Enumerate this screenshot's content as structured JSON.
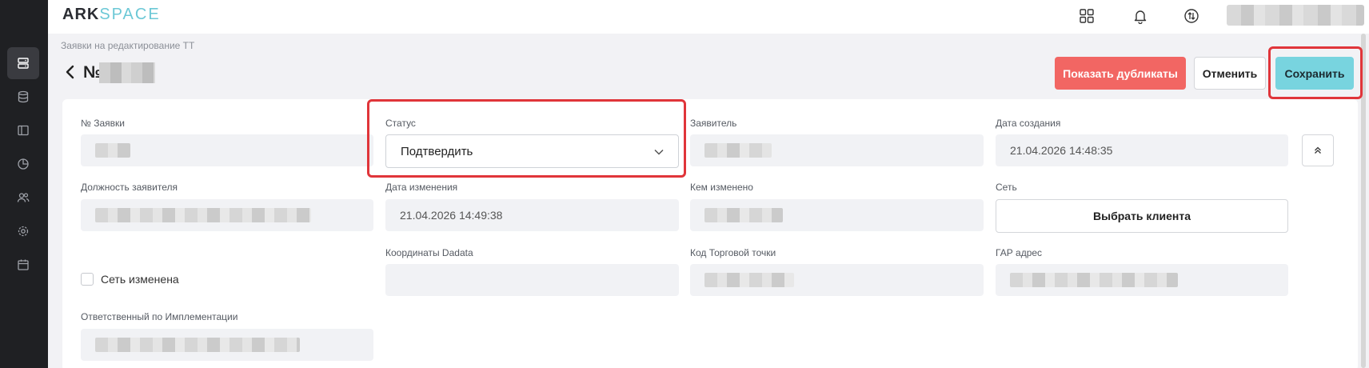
{
  "app": {
    "logo_part1": "ARK",
    "logo_part2": "SPACE"
  },
  "header": {
    "icons": [
      "grid-icon",
      "bell-icon",
      "exchange-icon"
    ]
  },
  "sidebar": {
    "items": [
      {
        "icon": "server-icon",
        "active": true
      },
      {
        "icon": "database-icon",
        "active": false
      },
      {
        "icon": "layout-icon",
        "active": false
      },
      {
        "icon": "pie-chart-icon",
        "active": false
      },
      {
        "icon": "users-icon",
        "active": false
      },
      {
        "icon": "settings-icon",
        "active": false
      },
      {
        "icon": "calendar-icon",
        "active": false
      }
    ]
  },
  "breadcrumb": "Заявки на редактирование ТТ",
  "page": {
    "title_prefix": "№"
  },
  "toolbar": {
    "show_duplicates": "Показать дубликаты",
    "cancel": "Отменить",
    "save": "Сохранить"
  },
  "form": {
    "request_no_label": "№ Заявки",
    "status_label": "Статус",
    "status_value": "Подтвердить",
    "applicant_label": "Заявитель",
    "created_label": "Дата создания",
    "created_value": "21.04.2026 14:48:35",
    "position_label": "Должность заявителя",
    "changed_label": "Дата изменения",
    "changed_value": "21.04.2026 14:49:38",
    "changed_by_label": "Кем изменено",
    "network_label": "Сеть",
    "choose_client": "Выбрать клиента",
    "network_changed_label": "Сеть изменена",
    "network_changed_checked": false,
    "dadata_label": "Координаты Dadata",
    "outlet_code_label": "Код Торговой точки",
    "gar_label": "ГАР адрес",
    "implementation_label": "Ответственный по Имплементации"
  },
  "colors": {
    "accent_save": "#78d4df",
    "danger": "#f26663",
    "sidebar_bg": "#1f2023",
    "highlight": "#e0353a"
  }
}
